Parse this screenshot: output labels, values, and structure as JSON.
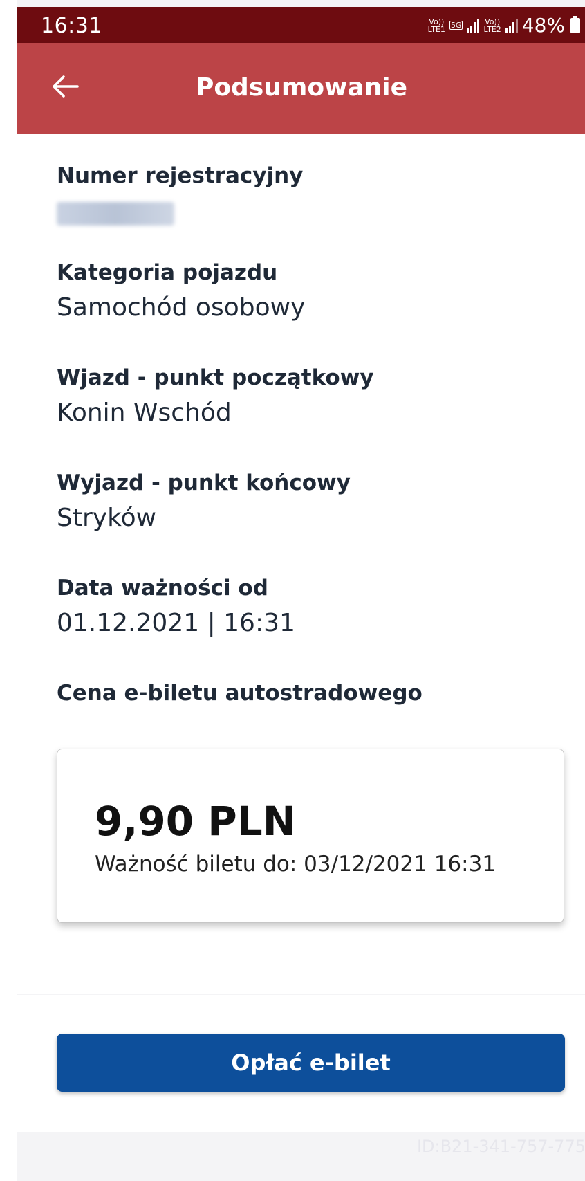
{
  "status_bar": {
    "time": "16:31",
    "sim1_badge": "Vo))\nLTE1",
    "network_badge": "5G",
    "sim2_badge": "Vo))\nLTE2",
    "battery_text": "48%"
  },
  "app_bar": {
    "title": "Podsumowanie",
    "back_icon": "arrow-left-icon"
  },
  "summary": {
    "registration": {
      "label": "Numer rejestracyjny",
      "value_obscured": true
    },
    "vehicle_category": {
      "label": "Kategoria pojazdu",
      "value": "Samochód osobowy"
    },
    "entry_point": {
      "label": "Wjazd - punkt początkowy",
      "value": "Konin Wschód"
    },
    "exit_point": {
      "label": "Wyjazd - punkt końcowy",
      "value": "Stryków"
    },
    "valid_from": {
      "label": "Data ważności od",
      "value": "01.12.2021 | 16:31"
    },
    "price_label": "Cena e-biletu autostradowego"
  },
  "price_card": {
    "amount": "9,90 PLN",
    "validity": "Ważność biletu do: 03/12/2021 16:31"
  },
  "actions": {
    "pay_label": "Opłać e-bilet"
  },
  "watermark": "ID:B21-341-757-775",
  "colors": {
    "status_bar": "#6e0c10",
    "app_bar": "#bc4447",
    "primary_button": "#0d4f9b",
    "background": "#f4f4f6"
  }
}
